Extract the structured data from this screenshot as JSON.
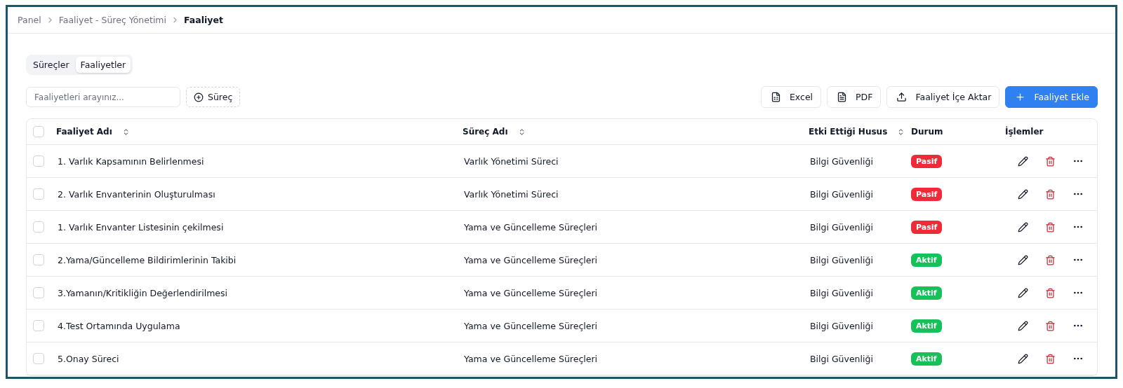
{
  "breadcrumb": [
    {
      "label": "Panel",
      "current": false
    },
    {
      "label": "Faaliyet - Süreç Yönetimi",
      "current": false
    },
    {
      "label": "Faaliyet",
      "current": true
    }
  ],
  "tabs": [
    {
      "label": "Süreçler",
      "selected": false
    },
    {
      "label": "Faaliyetler",
      "selected": true
    }
  ],
  "search": {
    "placeholder": "Faaliyetleri arayınız..."
  },
  "filter_button": "Süreç",
  "actions": [
    {
      "kind": "xls",
      "label": "Excel"
    },
    {
      "kind": "pdf",
      "label": "PDF"
    },
    {
      "kind": "import",
      "label": "Faaliyet İçe Aktar"
    },
    {
      "kind": "add",
      "label": "Faaliyet Ekle"
    }
  ],
  "table": {
    "all_checked": false,
    "columns": [
      {
        "label": "Faaliyet Adı",
        "sortable": true
      },
      {
        "label": "Süreç Adı",
        "sortable": true
      },
      {
        "label": "Etki Ettiği Husus",
        "sortable": true
      },
      {
        "label": "Durum",
        "sortable": false
      },
      {
        "label": "İşlemler",
        "sortable": false
      }
    ],
    "rows": [
      {
        "name": "1. Varlık Kapsamının Belirlenmesi",
        "process": "Varlık Yönetimi Süreci",
        "aspect": "Bilgi Güvenliği",
        "status": "Pasif",
        "kind": "passive",
        "checked": false
      },
      {
        "name": "2. Varlık Envanterinin Oluşturulması",
        "process": "Varlık Yönetimi Süreci",
        "aspect": "Bilgi Güvenliği",
        "status": "Pasif",
        "kind": "passive",
        "checked": false
      },
      {
        "name": "1. Varlık Envanter Listesinin çekilmesi",
        "process": "Yama ve Güncelleme Süreçleri",
        "aspect": "Bilgi Güvenliği",
        "status": "Pasif",
        "kind": "passive",
        "checked": false
      },
      {
        "name": "2.Yama/Güncelleme Bildirimlerinin Takibi",
        "process": "Yama ve Güncelleme Süreçleri",
        "aspect": "Bilgi Güvenliği",
        "status": "Aktif",
        "kind": "active",
        "checked": false
      },
      {
        "name": "3.Yamanın/Kritikliğin Değerlendirilmesi",
        "process": "Yama ve Güncelleme Süreçleri",
        "aspect": "Bilgi Güvenliği",
        "status": "Aktif",
        "kind": "active",
        "checked": false
      },
      {
        "name": "4.Test Ortamında Uygulama",
        "process": "Yama ve Güncelleme Süreçleri",
        "aspect": "Bilgi Güvenliği",
        "status": "Aktif",
        "kind": "active",
        "checked": false
      },
      {
        "name": "5.Onay Süreci",
        "process": "Yama ve Güncelleme Süreçleri",
        "aspect": "Bilgi Güvenliği",
        "status": "Aktif",
        "kind": "active",
        "checked": false
      }
    ]
  }
}
